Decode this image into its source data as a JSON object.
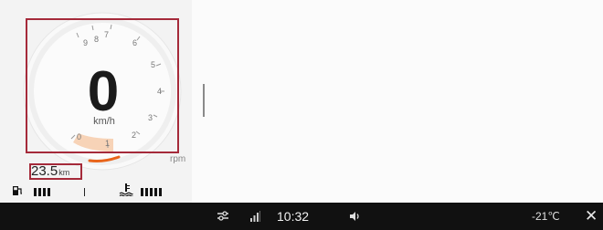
{
  "cluster": {
    "speed": "0",
    "speed_unit": "km/h",
    "rpm_label": "rpm",
    "rpm_ticks": [
      "0",
      "1",
      "2",
      "3",
      "4",
      "5",
      "6",
      "7",
      "8",
      "9"
    ],
    "odometer_value": "23.5",
    "odometer_unit": "km",
    "fuel_bars": 4,
    "coolant_bars": 5,
    "accent_color": "#e8641a",
    "highlight_color": "#a52a3a"
  },
  "status_bar": {
    "time": "10:32",
    "outside_temp": "-21℃",
    "icons": [
      "settings-sliders-icon",
      "signal-icon",
      "volume-icon",
      "close-icon"
    ]
  }
}
